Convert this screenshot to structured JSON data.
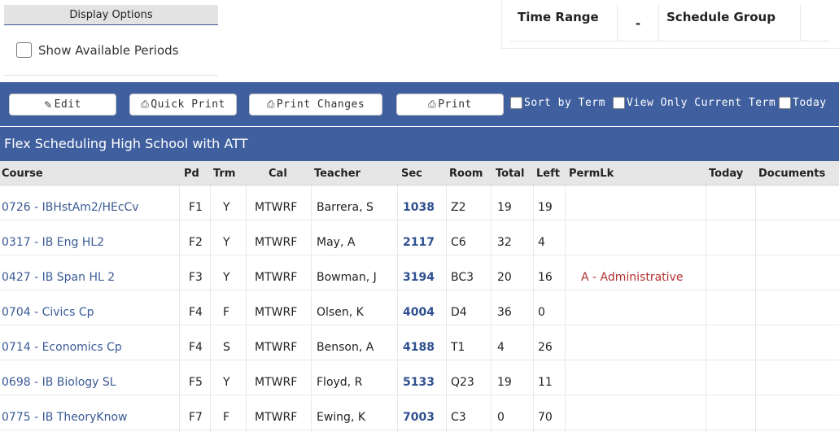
{
  "display_options": {
    "title": "Display Options",
    "show_available_periods_label": "Show Available Periods"
  },
  "time_range": {
    "label": "Time Range",
    "value": "-",
    "schedule_group_label": "Schedule Group"
  },
  "toolbar": {
    "edit_label": "Edit",
    "quick_print_label": "Quick Print",
    "print_changes_label": "Print Changes",
    "print_label": "Print",
    "sort_by_term_label": "Sort by Term",
    "view_only_current_term_label": "View Only Current Term",
    "today_label": "Today"
  },
  "school_name": "Flex Scheduling High School with ATT",
  "table": {
    "headers": {
      "course": "Course",
      "pd": "Pd",
      "trm": "Trm",
      "cal": "Cal",
      "teacher": "Teacher",
      "sec": "Sec",
      "room": "Room",
      "total": "Total",
      "left": "Left",
      "permlk": "PermLk",
      "today": "Today",
      "documents": "Documents"
    },
    "rows": [
      {
        "course": "0726 - IBHstAm2/HEcCv",
        "pd": "F1",
        "trm": "Y",
        "cal": "MTWRF",
        "teacher": "Barrera, S",
        "sec": "1038",
        "room": "Z2",
        "total": "19",
        "left": "19",
        "permlk": ""
      },
      {
        "course": "0317 - IB Eng HL2",
        "pd": "F2",
        "trm": "Y",
        "cal": "MTWRF",
        "teacher": "May, A",
        "sec": "2117",
        "room": "C6",
        "total": "32",
        "left": "4",
        "permlk": ""
      },
      {
        "course": "0427 - IB Span HL 2",
        "pd": "F3",
        "trm": "Y",
        "cal": "MTWRF",
        "teacher": "Bowman, J",
        "sec": "3194",
        "room": "BC3",
        "total": "20",
        "left": "16",
        "permlk": "A - Administrative"
      },
      {
        "course": "0704 - Civics Cp",
        "pd": "F4",
        "trm": "F",
        "cal": "MTWRF",
        "teacher": "Olsen, K",
        "sec": "4004",
        "room": "D4",
        "total": "36",
        "left": "0",
        "permlk": ""
      },
      {
        "course": "0714 - Economics Cp",
        "pd": "F4",
        "trm": "S",
        "cal": "MTWRF",
        "teacher": "Benson, A",
        "sec": "4188",
        "room": "T1",
        "total": "4",
        "left": "26",
        "permlk": ""
      },
      {
        "course": "0698 - IB Biology SL",
        "pd": "F5",
        "trm": "Y",
        "cal": "MTWRF",
        "teacher": "Floyd, R",
        "sec": "5133",
        "room": "Q23",
        "total": "19",
        "left": "11",
        "permlk": ""
      },
      {
        "course": "0775 - IB TheoryKnow",
        "pd": "F7",
        "trm": "F",
        "cal": "MTWRF",
        "teacher": "Ewing, K",
        "sec": "7003",
        "room": "C3",
        "total": "0",
        "left": "70",
        "permlk": ""
      }
    ]
  },
  "colors": {
    "toolbar_blue": "#3f5f9f",
    "link_blue": "#3a5a95",
    "perm_red": "#b03030"
  }
}
